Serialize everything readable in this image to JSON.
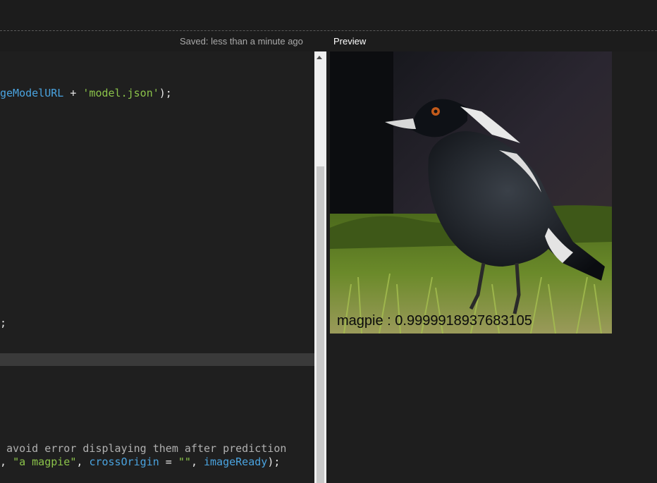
{
  "header": {
    "save_status": "Saved: less than a minute ago",
    "preview_tab": "Preview"
  },
  "editor": {
    "lines": [
      [
        {
          "t": "geModelURL",
          "c": "var"
        },
        {
          "t": " + ",
          "c": "plain"
        },
        {
          "t": "'model.json'",
          "c": "str"
        },
        {
          "t": ");",
          "c": "plain"
        }
      ],
      [
        {
          "t": ";",
          "c": "plain"
        }
      ],
      [
        {
          "t": " avoid error displaying them after prediction",
          "c": "comment"
        }
      ],
      [
        {
          "t": ", ",
          "c": "plain"
        },
        {
          "t": "\"a magpie\"",
          "c": "str"
        },
        {
          "t": ", ",
          "c": "plain"
        },
        {
          "t": "crossOrigin",
          "c": "var"
        },
        {
          "t": " = ",
          "c": "plain"
        },
        {
          "t": "\"\"",
          "c": "str"
        },
        {
          "t": ", ",
          "c": "plain"
        },
        {
          "t": "imageReady",
          "c": "var"
        },
        {
          "t": ");",
          "c": "plain"
        }
      ]
    ]
  },
  "preview": {
    "image_subject": "magpie",
    "prediction_text": "magpie : 0.9999918937683105"
  },
  "colors": {
    "background": "#1c1c1c",
    "editor_bg": "#1f1f1f",
    "variable": "#4aa3df",
    "string": "#8bc34a",
    "comment": "#b0b0b0",
    "plain": "#e6e6e6"
  }
}
